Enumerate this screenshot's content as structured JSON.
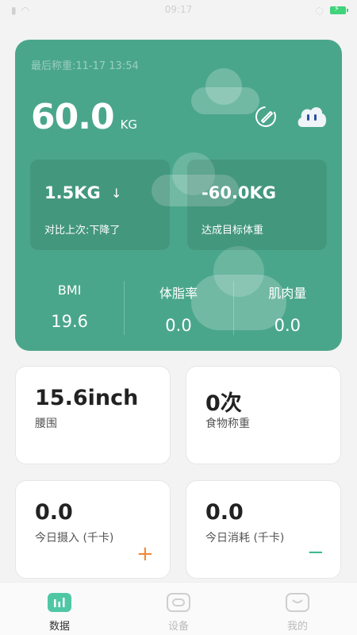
{
  "status_bar": {
    "time": "09:17"
  },
  "summary": {
    "last_weigh": "最后称重:11-17 13:54",
    "weight": "60.0",
    "unit": "KG"
  },
  "compare_card": {
    "value": "1.5KG",
    "arrow": "↓",
    "label": "对比上次:下降了"
  },
  "goal_card": {
    "value": "-60.0KG",
    "label": "达成目标体重"
  },
  "metrics": [
    {
      "label": "BMI",
      "value": "19.6"
    },
    {
      "label": "体脂率",
      "value": "0.0"
    },
    {
      "label": "肌肉量",
      "value": "0.0"
    }
  ],
  "cards": {
    "waist": {
      "value": "15.6inch",
      "label": "腰围"
    },
    "food": {
      "value": "0次",
      "label": "食物称重"
    },
    "intake": {
      "value": "0.0",
      "label": "今日摄入 (千卡)",
      "action": "+"
    },
    "burn": {
      "value": "0.0",
      "label": "今日消耗 (千卡)",
      "action": "−"
    }
  },
  "tabs": [
    {
      "label": "数据",
      "icon": "chart-icon",
      "active": true
    },
    {
      "label": "设备",
      "icon": "device-icon",
      "active": false
    },
    {
      "label": "我的",
      "icon": "profile-icon",
      "active": false
    }
  ],
  "colors": {
    "accent": "#4aa68a",
    "plus": "#ef8a3c",
    "minus": "#3fb894"
  }
}
